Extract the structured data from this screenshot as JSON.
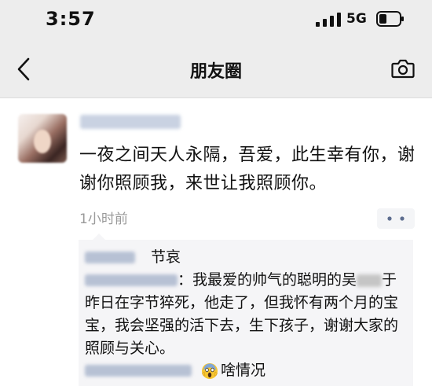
{
  "status_bar": {
    "time": "3:57",
    "network": "5G",
    "icons": [
      "signal-bars-icon",
      "battery-icon"
    ]
  },
  "nav": {
    "title": "朋友圈",
    "icons": [
      "chevron-left-icon",
      "camera-icon"
    ]
  },
  "post": {
    "text": "一夜之间天人永隔，吾爱，此生幸有你，谢谢你照顾我，来世让我照顾你。",
    "time": "1小时前",
    "icons": [
      "more-dots-icon"
    ]
  },
  "comments": [
    {
      "text": "节哀"
    },
    {
      "text_before": "：我最爱的帅气的聪明的吴",
      "text_after": "于昨日在字节猝死，他走了，但我怀有两个月的宝宝，我会坚强的活下去，生下孩子，谢谢大家的照顾与关心。"
    },
    {
      "text": "啥情况",
      "icons": [
        "face-screaming-emoji-icon"
      ]
    }
  ],
  "colors": {
    "header_bg": "#ededed",
    "comment_bg": "#f5f5f7",
    "timestamp": "#9a9a9a"
  }
}
